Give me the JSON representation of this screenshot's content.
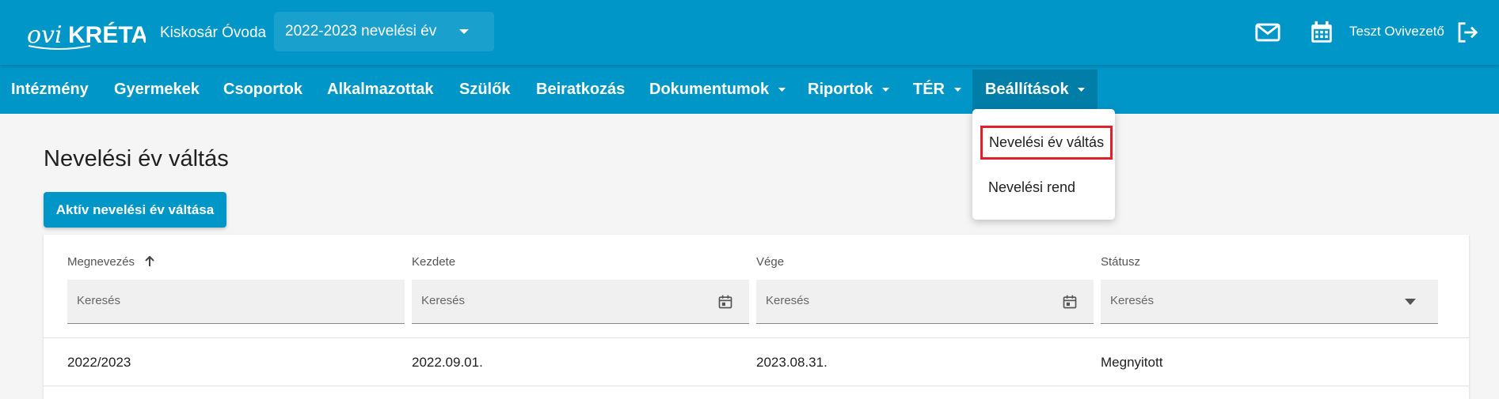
{
  "header": {
    "logo_alt": "oviKRÉTA",
    "institution": "Kiskosár Óvoda",
    "year_select": "2022-2023 nevelési év",
    "username": "Teszt Ovivezető"
  },
  "nav": {
    "items": [
      {
        "label": "Intézmény"
      },
      {
        "label": "Gyermekek"
      },
      {
        "label": "Csoportok"
      },
      {
        "label": "Alkalmazottak"
      },
      {
        "label": "Szülők"
      },
      {
        "label": "Beiratkozás"
      },
      {
        "label": "Dokumentumok"
      },
      {
        "label": "Riportok"
      },
      {
        "label": "TÉR"
      },
      {
        "label": "Beállítások"
      }
    ]
  },
  "dropdown": {
    "items": [
      {
        "label": "Nevelési év váltás"
      },
      {
        "label": "Nevelési rend"
      }
    ]
  },
  "main": {
    "title": "Nevelési év váltás",
    "primary_button": "Aktív nevelési év váltása",
    "table": {
      "columns": [
        "Megnevezés",
        "Kezdete",
        "Vége",
        "Státusz"
      ],
      "filter_placeholder": "Keresés",
      "rows": [
        [
          "2022/2023",
          "2022.09.01.",
          "2023.08.31.",
          "Megnyitott"
        ]
      ]
    }
  },
  "colors": {
    "brand": "#0096c7",
    "nav_active": "#007ea8",
    "highlight": "#e0202a"
  }
}
